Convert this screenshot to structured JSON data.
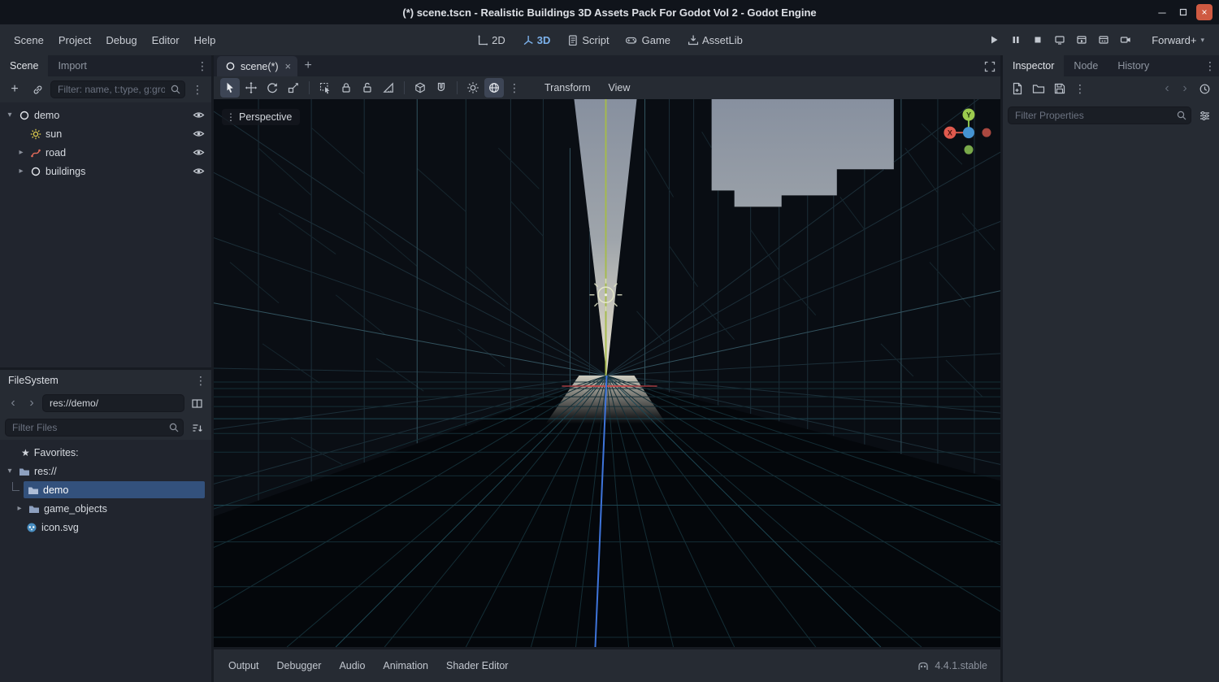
{
  "titlebar": {
    "title": "(*) scene.tscn - Realistic Buildings 3D Assets Pack For Godot Vol 2 - Godot Engine"
  },
  "menubar": {
    "items": [
      "Scene",
      "Project",
      "Debug",
      "Editor",
      "Help"
    ],
    "workspaces": [
      "2D",
      "3D",
      "Script",
      "Game",
      "AssetLib"
    ],
    "renderer": "Forward+"
  },
  "scene_dock": {
    "tabs": [
      "Scene",
      "Import"
    ],
    "filter_placeholder": "Filter: name, t:type, g:group",
    "nodes": [
      {
        "label": "demo"
      },
      {
        "label": "sun"
      },
      {
        "label": "road"
      },
      {
        "label": "buildings"
      }
    ]
  },
  "filesystem_dock": {
    "title": "FileSystem",
    "path": "res://demo/",
    "filter_placeholder": "Filter Files",
    "favorites": "Favorites:",
    "items": [
      {
        "label": "res://"
      },
      {
        "label": "demo"
      },
      {
        "label": "game_objects"
      },
      {
        "label": "icon.svg"
      }
    ]
  },
  "center": {
    "scene_tab": "scene(*)",
    "menus": {
      "transform": "Transform",
      "view": "View"
    },
    "viewport": {
      "projection": "Perspective"
    },
    "axis": {
      "x": "X",
      "y": "Y"
    }
  },
  "inspector_dock": {
    "tabs": [
      "Inspector",
      "Node",
      "History"
    ],
    "filter_placeholder": "Filter Properties"
  },
  "bottom_bar": {
    "panels": [
      "Output",
      "Debugger",
      "Audio",
      "Animation",
      "Shader Editor"
    ],
    "version": "4.4.1.stable"
  }
}
